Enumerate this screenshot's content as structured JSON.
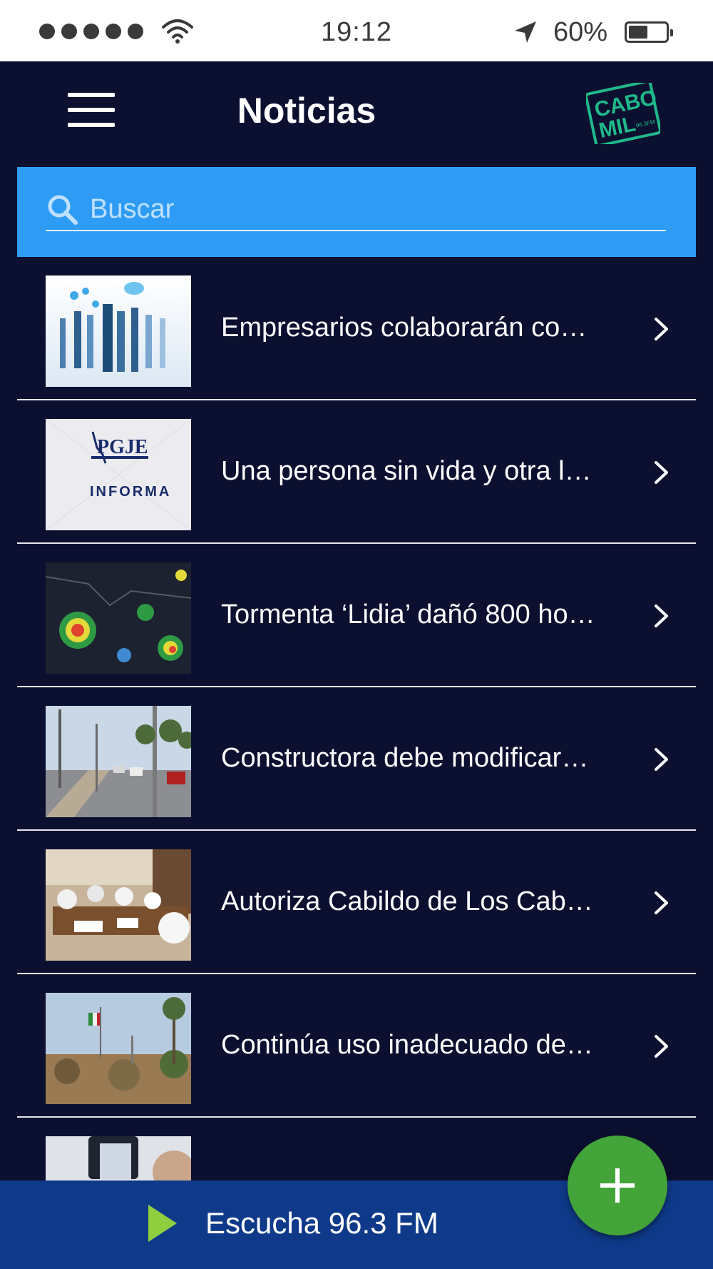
{
  "status_bar": {
    "time": "19:12",
    "battery_percent": "60%",
    "battery_level": 0.6,
    "signal_bars": 5,
    "icons": [
      "signal-dots",
      "wifi-icon",
      "location-arrow-icon",
      "battery-icon"
    ]
  },
  "header": {
    "title": "Noticias",
    "menu_icon": "hamburger-menu-icon",
    "logo_alt": "Cabo Mil logo",
    "logo_text": [
      "CABO",
      "MIL",
      "96.3FM"
    ]
  },
  "search": {
    "placeholder": "Buscar",
    "value": "",
    "icon": "search-icon"
  },
  "news": [
    {
      "title": "Empresarios colaborarán co…",
      "thumbnail": "business-people-photo"
    },
    {
      "title": "Una persona sin vida y otra l…",
      "thumbnail": "pgje-informa-graphic",
      "thumb_text": [
        "PGJE",
        "INFORMA"
      ]
    },
    {
      "title": "Tormenta ‘Lidia’ dañó 800 ho…",
      "thumbnail": "storm-satellite-map"
    },
    {
      "title": "Constructora debe modificar…",
      "thumbnail": "street-photo"
    },
    {
      "title": "Autoriza Cabildo de Los Cab…",
      "thumbnail": "council-meeting-photo"
    },
    {
      "title": "Continúa uso inadecuado de…",
      "thumbnail": "landscape-flag-photo"
    },
    {
      "title": "",
      "thumbnail": "phone-photo-partial"
    }
  ],
  "fab": {
    "icon": "plus-icon"
  },
  "player": {
    "label": "Escucha 96.3 FM",
    "icon": "play-icon"
  },
  "colors": {
    "background": "#0c1030",
    "search_bar": "#2e9cf5",
    "player_bar": "#0f3a8a",
    "fab": "#43a43a",
    "logo": "#1fb98a"
  }
}
